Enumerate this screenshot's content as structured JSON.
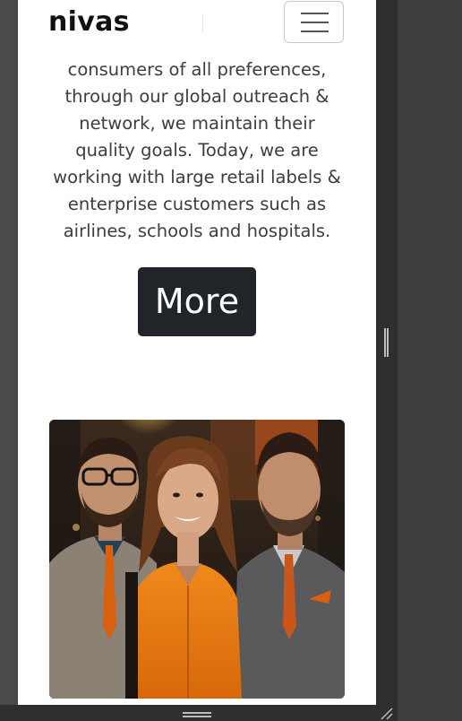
{
  "navbar": {
    "brand": "nivas",
    "menu_icon": "hamburger-menu-icon"
  },
  "content": {
    "partial_line": "consumers of all preferences,",
    "lines": [
      "through our global outreach &",
      "network, we maintain their",
      "quality goals. Today, we are",
      "working with large retail labels &",
      "enterprise customers such as",
      "airlines, schools and hospitals."
    ],
    "more_button": "More"
  },
  "image": {
    "subject": "three people in business attire, woman in orange shirt in center"
  },
  "colors": {
    "button_bg": "#212529",
    "text": "#3d3d3d",
    "accent_orange": "#e8770f"
  }
}
